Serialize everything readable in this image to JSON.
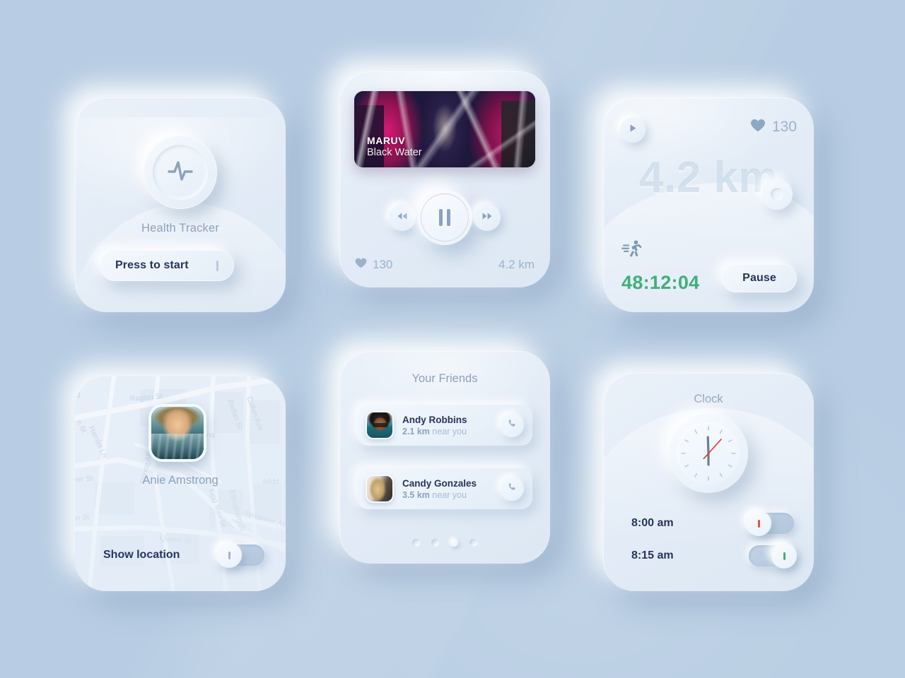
{
  "theme": {
    "background": "#b8cde3",
    "card_surface": "#e6eef8",
    "text_dark": "#26355c",
    "text_muted": "#8ca2bc",
    "accent_green": "#3fb07a",
    "accent_red": "#e8523f"
  },
  "health_card": {
    "icon": "heartbeat-pulse-icon",
    "caption": "Health Tracker",
    "button_label": "Press to start"
  },
  "music_card": {
    "album": {
      "artist": "MARUV",
      "track": "Black Water"
    },
    "controls": {
      "previous": "rewind-icon",
      "play_pause": "pause-icon",
      "next": "fast-forward-icon"
    },
    "stats": {
      "heart_icon": "heart-icon",
      "heart_rate": "130",
      "distance": "4.2 km"
    }
  },
  "run_card": {
    "play_icon": "play-icon",
    "heart_icon": "heart-icon",
    "heart_rate": "130",
    "distance": "4.2 km",
    "runner_icon": "running-person-icon",
    "timer": "48:12:04",
    "pause_label": "Pause"
  },
  "map_card": {
    "person_name": "Anie Amstrong",
    "avatar": "user-photo-swimming",
    "footer_label": "Show location",
    "toggle_state": "off",
    "streets": [
      "Raglan St",
      "Hamlet Ln",
      "Cullen Ave",
      "Redan St",
      "Prince Albert St",
      "King Max St",
      "Effingham St",
      "Alexander Av",
      "Queen St",
      "Midd",
      "ner St",
      "en St",
      "rd",
      "n St",
      "na"
    ]
  },
  "friends_card": {
    "title": "Your Friends",
    "friends": [
      {
        "name": "Andy Robbins",
        "distance": "2.1 km",
        "distance_suffix": " near you",
        "call_icon": "phone-icon",
        "avatar": "andy-photo"
      },
      {
        "name": "Candy Gonzales",
        "distance": "3.5 km",
        "distance_suffix": " near you",
        "call_icon": "phone-icon",
        "avatar": "candy-photo"
      }
    ],
    "pager": {
      "count": 4,
      "active_index": 2
    }
  },
  "clock_card": {
    "title": "Clock",
    "clock_face": {
      "hour_hand_deg": 358,
      "minute_hand_deg": 180,
      "second_hand_deg": 42,
      "tick_count": 12
    },
    "alarms": [
      {
        "time": "8:00 am",
        "state": "off"
      },
      {
        "time": "8:15 am",
        "state": "on"
      }
    ]
  }
}
